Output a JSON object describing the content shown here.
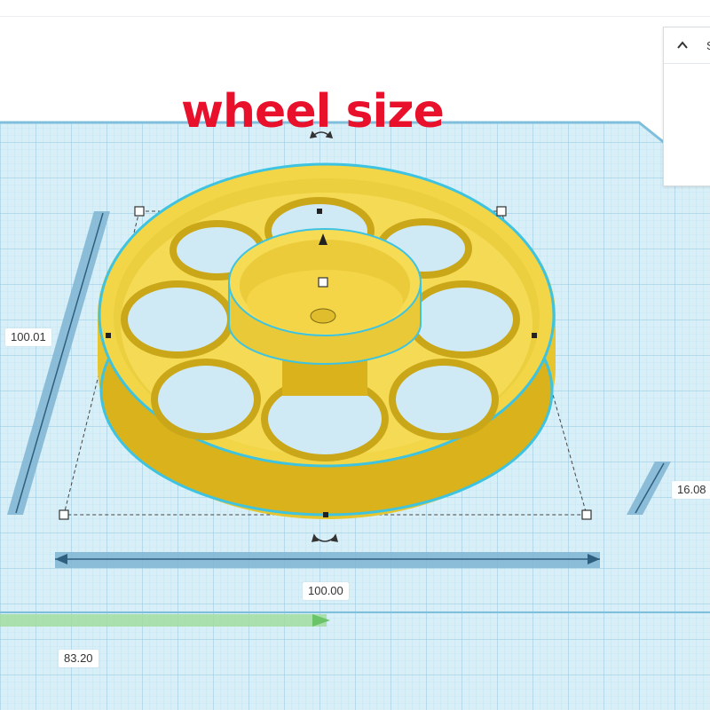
{
  "caption": "wheel size",
  "shape_panel": {
    "collapse_icon": "chevron-up-icon",
    "label": "S"
  },
  "dimensions": {
    "height": "100.01",
    "width": "100.00",
    "elevation": "16.08",
    "length": "83.20"
  },
  "colors": {
    "workplane": "#cfeaf5",
    "grid_line": "#a9d3e8",
    "shape_fill": "#f0d43c",
    "shape_outline": "#3ec3e0",
    "caption": "#e8102a",
    "ruler": "#5a8aa8",
    "x_axis_ruler": "#8ed08a"
  }
}
